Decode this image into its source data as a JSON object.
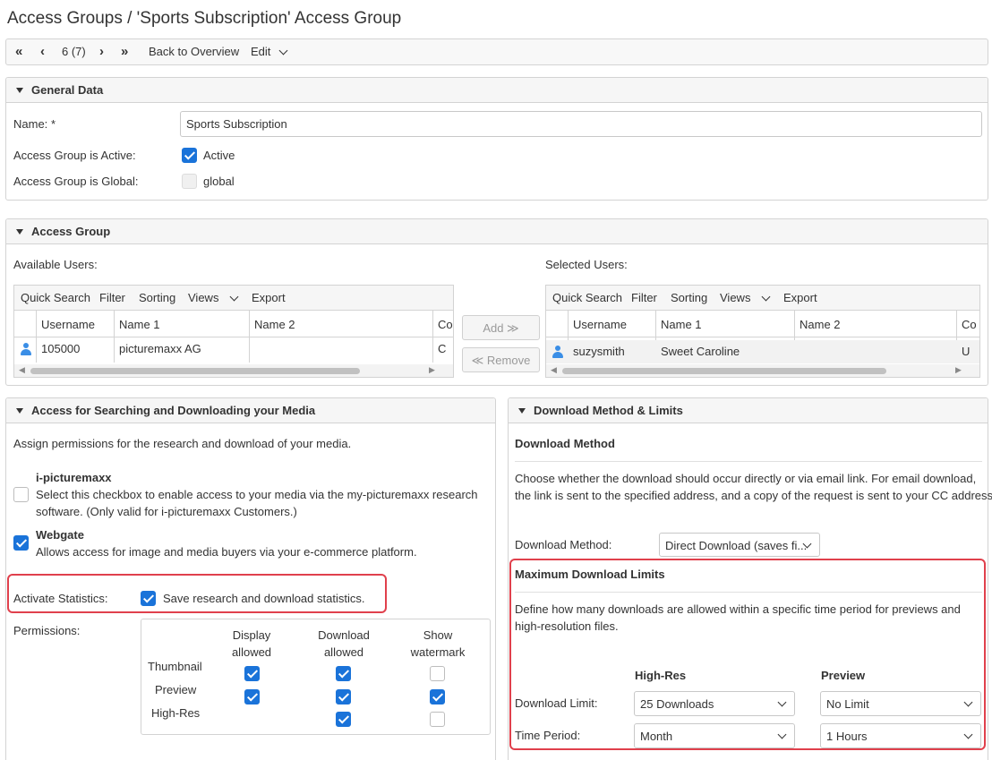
{
  "page": {
    "title": "Access Groups / 'Sports Subscription' Access Group"
  },
  "navbar": {
    "position": "6 (7)",
    "back_label": "Back to Overview",
    "edit_label": "Edit"
  },
  "general": {
    "title": "General Data",
    "name_label": "Name:",
    "required_mark": "*",
    "name_value": "Sports Subscription",
    "active_label": "Access Group is Active:",
    "active_text": "Active",
    "global_label": "Access Group is Global:",
    "global_text": "global"
  },
  "access_group": {
    "title": "Access Group",
    "available_label": "Available Users:",
    "selected_label": "Selected Users:",
    "toolbar": {
      "quick_search": "Quick Search",
      "filter": "Filter",
      "sorting": "Sorting",
      "views": "Views",
      "export": "Export"
    },
    "columns": [
      "Username",
      "Name 1",
      "Name 2",
      "Co"
    ],
    "available_row": {
      "username": "105000",
      "name1": "picturemaxx AG",
      "name2": "",
      "extra": "C"
    },
    "selected_row": {
      "username": "suzysmith",
      "name1": "Sweet Caroline",
      "name2": "",
      "extra": "U"
    },
    "add_label": "Add ≫",
    "remove_label": "≪ Remove"
  },
  "search": {
    "title": "Access for Searching and Downloading your Media",
    "intro": "Assign permissions for the research and download of your media.",
    "ipm_title": "i-picturemaxx",
    "ipm_desc_1": "Select this checkbox to enable access to your media via the my-picturemaxx research",
    "ipm_desc_2": "software. (Only valid for i-picturemaxx Customers.)",
    "webgate_title": "Webgate",
    "webgate_desc": "Allows access for image and media buyers via your e-commerce platform.",
    "stats_label": "Activate Statistics:",
    "stats_text": "Save research and download statistics.",
    "permissions_label": "Permissions:",
    "perm_cols": [
      {
        "l1": "Display",
        "l2": "allowed"
      },
      {
        "l1": "Download",
        "l2": "allowed"
      },
      {
        "l1": "Show",
        "l2": "watermark"
      }
    ],
    "perm_rows": [
      "Thumbnail",
      "Preview",
      "High-Res"
    ]
  },
  "download": {
    "title": "Download Method & Limits",
    "method_heading": "Download Method",
    "method_desc_1": "Choose whether the download should occur directly or via email link. For email download,",
    "method_desc_2": "the link is sent to the specified address, and a copy of the request is sent to your CC address.",
    "method_label": "Download Method:",
    "method_value": "Direct Download (saves fi...",
    "limits_heading": "Maximum Download Limits",
    "limits_desc_1": "Define how many downloads are allowed within a specific time period for previews and",
    "limits_desc_2": "high-resolution files.",
    "col_highres": "High-Res",
    "col_preview": "Preview",
    "limit_label": "Download Limit:",
    "period_label": "Time Period:",
    "highres_limit": "25 Downloads",
    "preview_limit": "No Limit",
    "highres_period": "Month",
    "preview_period": "1 Hours"
  },
  "colors": {
    "accent": "#1a73d9",
    "highlight": "#e0404c"
  },
  "icons": [
    "first-page-icon",
    "prev-page-icon",
    "next-page-icon",
    "last-page-icon",
    "chevron-down-icon",
    "user-icon",
    "collapse-triangle-icon",
    "checkbox-checked-icon"
  ]
}
